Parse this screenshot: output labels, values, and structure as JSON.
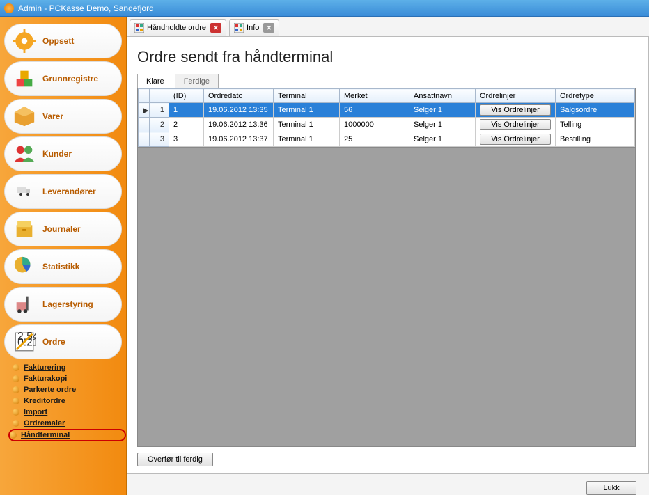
{
  "window": {
    "title": "Admin - PCKasse Demo, Sandefjord"
  },
  "sidebar": {
    "items": [
      {
        "label": "Oppsett"
      },
      {
        "label": "Grunnregistre"
      },
      {
        "label": "Varer"
      },
      {
        "label": "Kunder"
      },
      {
        "label": "Leverandører"
      },
      {
        "label": "Journaler"
      },
      {
        "label": "Statistikk"
      },
      {
        "label": "Lagerstyring"
      },
      {
        "label": "Ordre"
      }
    ],
    "sublinks": [
      {
        "label": "Fakturering"
      },
      {
        "label": "Fakturakopi"
      },
      {
        "label": "Parkerte ordre"
      },
      {
        "label": "Kreditordre"
      },
      {
        "label": "Import"
      },
      {
        "label": "Ordremaler"
      },
      {
        "label": "Håndterminal"
      }
    ]
  },
  "tabs": [
    {
      "label": "Håndholdte ordre",
      "close_style": "red"
    },
    {
      "label": "Info",
      "close_style": "grey"
    }
  ],
  "page": {
    "title": "Ordre sendt fra håndterminal"
  },
  "inner_tabs": [
    {
      "label": "Klare",
      "active": true
    },
    {
      "label": "Ferdige",
      "active": false
    }
  ],
  "grid": {
    "headers": {
      "id": "(ID)",
      "ordredato": "Ordredato",
      "terminal": "Terminal",
      "merket": "Merket",
      "ansattnavn": "Ansattnavn",
      "ordrelinjer": "Ordrelinjer",
      "ordretype": "Ordretype"
    },
    "button_label": "Vis Ordrelinjer",
    "rows": [
      {
        "num": "1",
        "id": "1",
        "ordredato": "19.06.2012 13:35",
        "terminal": "Terminal 1",
        "merket": "56",
        "ansatt": "Selger 1",
        "type": "Salgsordre",
        "selected": true
      },
      {
        "num": "2",
        "id": "2",
        "ordredato": "19.06.2012 13:36",
        "terminal": "Terminal 1",
        "merket": "1000000",
        "ansatt": "Selger 1",
        "type": "Telling",
        "selected": false
      },
      {
        "num": "3",
        "id": "3",
        "ordredato": "19.06.2012 13:37",
        "terminal": "Terminal 1",
        "merket": "25",
        "ansatt": "Selger 1",
        "type": "Bestilling",
        "selected": false
      }
    ]
  },
  "buttons": {
    "transfer": "Overfør til ferdig",
    "close": "Lukk"
  }
}
